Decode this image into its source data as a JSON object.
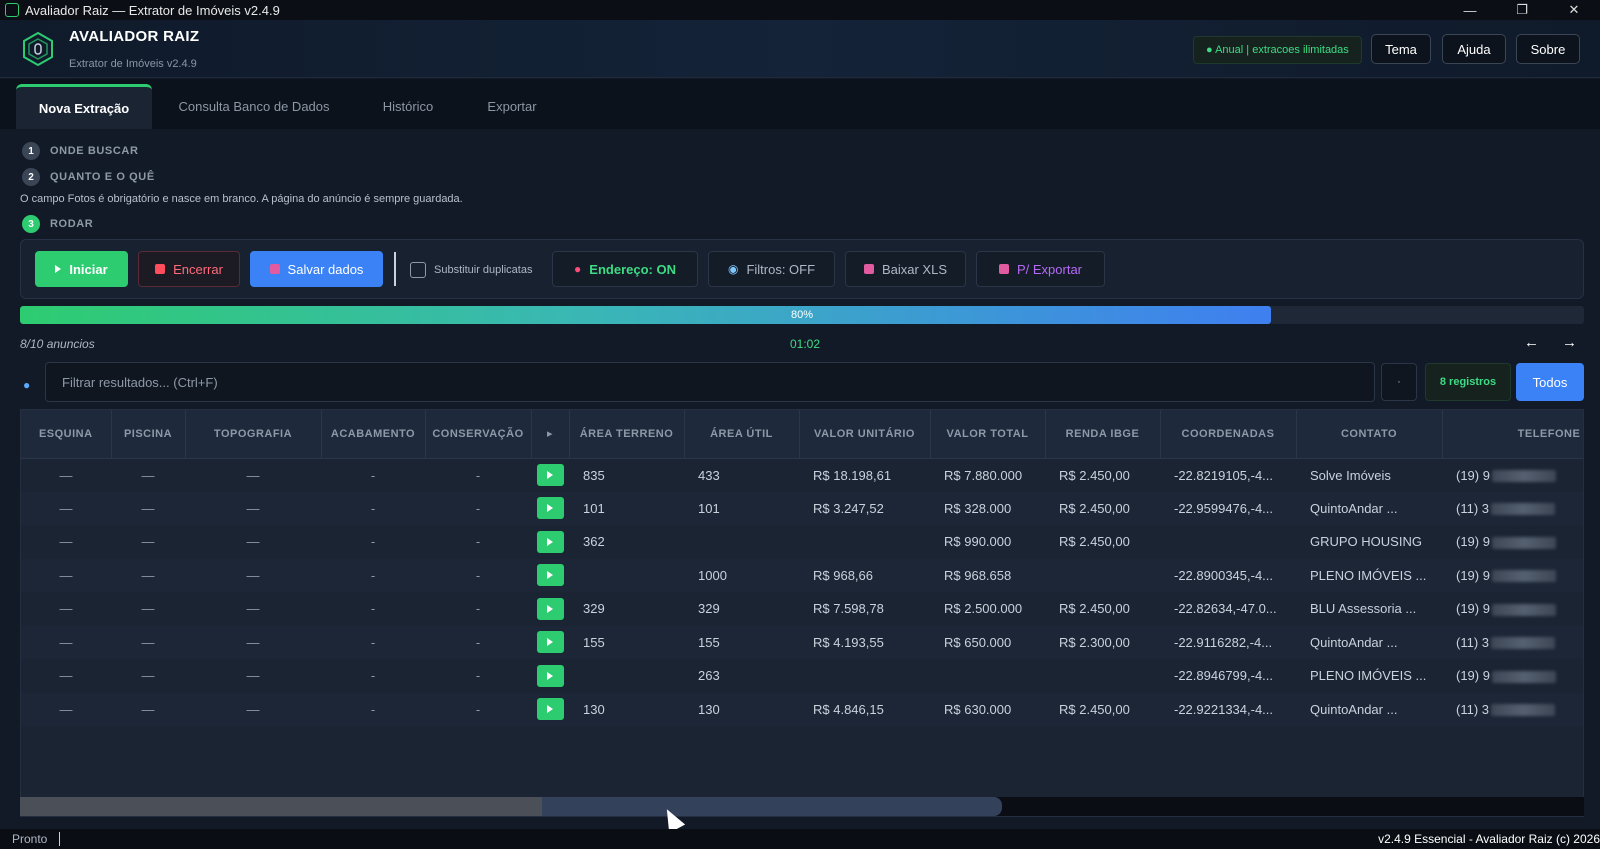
{
  "window": {
    "title": "Avaliador Raiz — Extrator de Imóveis v2.4.9",
    "minimize": "—",
    "maximize": "❐",
    "close": "✕"
  },
  "header": {
    "brand": "AVALIADOR RAIZ",
    "subtitle": "Extrator de Imóveis v2.4.9",
    "plan_badge": "● Anual | extracoes ilimitadas",
    "buttons": [
      "Tema",
      "Ajuda",
      "Sobre"
    ]
  },
  "tabs": [
    "Nova Extração",
    "Consulta Banco de Dados",
    "Histórico",
    "Exportar"
  ],
  "active_tab": "Nova Extração",
  "steps": [
    {
      "num": "1",
      "label": "ONDE BUSCAR"
    },
    {
      "num": "2",
      "label": "QUANTO E O QUÊ"
    },
    {
      "num": "3",
      "label": "RODAR"
    }
  ],
  "note": "O campo Fotos é obrigatório e nasce em branco. A página do anúncio é sempre guardada.",
  "toolbar": {
    "start": "Iniciar",
    "stop": "Encerrar",
    "save": "Salvar dados",
    "replace_duplicates": "Substituir duplicatas",
    "replace_duplicates_checked": false,
    "address": "Endereço: ON",
    "filters": "Filtros: OFF",
    "download_xls": "Baixar XLS",
    "to_export": "P/ Exportar"
  },
  "progress": {
    "fraction": 0.8,
    "label": "80%",
    "count": "8/10 anuncios",
    "timer": "01:02",
    "prev": "←",
    "next": "→"
  },
  "filter": {
    "placeholder": "Filtrar resultados... (Ctrl+F)",
    "small_button": "·",
    "records": "8 registros",
    "all": "Todos"
  },
  "table": {
    "columns": [
      "ESQUINA",
      "PISCINA",
      "TOPOGRAFIA",
      "ACABAMENTO",
      "CONSERVAÇÃO",
      "▸",
      "ÁREA TERRENO",
      "ÁREA ÚTIL",
      "VALOR UNITÁRIO",
      "VALOR TOTAL",
      "RENDA IBGE",
      "COORDENADAS",
      "CONTATO",
      "TELEFONE"
    ],
    "rows": [
      [
        "—",
        "—",
        "—",
        "-",
        "-",
        "",
        "835",
        "433",
        "R$ 18.198,61",
        "R$ 7.880.000",
        "R$ 2.450,00",
        "-22.8219105,-4...",
        "Solve Imóveis",
        "(19) 9"
      ],
      [
        "—",
        "—",
        "—",
        "-",
        "-",
        "",
        "101",
        "101",
        "R$ 3.247,52",
        "R$ 328.000",
        "R$ 2.450,00",
        "-22.9599476,-4...",
        "QuintoAndar ...",
        "(11) 3"
      ],
      [
        "—",
        "—",
        "—",
        "-",
        "-",
        "",
        "362",
        "",
        "",
        "R$ 990.000",
        "R$ 2.450,00",
        "",
        "GRUPO HOUSING",
        "(19) 9"
      ],
      [
        "—",
        "—",
        "—",
        "-",
        "-",
        "",
        "",
        "1000",
        "R$ 968,66",
        "R$ 968.658",
        "",
        "-22.8900345,-4...",
        "PLENO IMÓVEIS ...",
        "(19) 9"
      ],
      [
        "—",
        "—",
        "—",
        "-",
        "-",
        "",
        "329",
        "329",
        "R$ 7.598,78",
        "R$ 2.500.000",
        "R$ 2.450,00",
        "-22.82634,-47.0...",
        "BLU Assessoria ...",
        "(19) 9"
      ],
      [
        "—",
        "—",
        "—",
        "-",
        "-",
        "",
        "155",
        "155",
        "R$ 4.193,55",
        "R$ 650.000",
        "R$ 2.300,00",
        "-22.9116282,-4...",
        "QuintoAndar ...",
        "(11) 3"
      ],
      [
        "—",
        "—",
        "—",
        "-",
        "-",
        "",
        "",
        "263",
        "",
        "",
        "",
        "-22.8946799,-4...",
        "PLENO IMÓVEIS ...",
        "(19) 9"
      ],
      [
        "—",
        "—",
        "—",
        "-",
        "-",
        "",
        "130",
        "130",
        "R$ 4.846,15",
        "R$ 630.000",
        "R$ 2.450,00",
        "-22.9221334,-4...",
        "QuintoAndar ...",
        "(11) 3"
      ]
    ]
  },
  "status": {
    "left": "Pronto",
    "right": "v2.4.9 Essencial - Avaliador Raiz (c) 2026"
  },
  "colors": {
    "accent_green": "#2ecc71",
    "accent_blue": "#3b82f6",
    "danger": "#ff6b7b",
    "purple": "#b56af5",
    "background": "#121a27"
  },
  "icons": [
    "app-icon",
    "logo-icon",
    "play-icon",
    "stop-icon",
    "save-icon",
    "pin-icon",
    "magnifier-icon",
    "download-icon",
    "export-icon",
    "search-icon",
    "arrow-left-icon",
    "arrow-right-icon"
  ]
}
